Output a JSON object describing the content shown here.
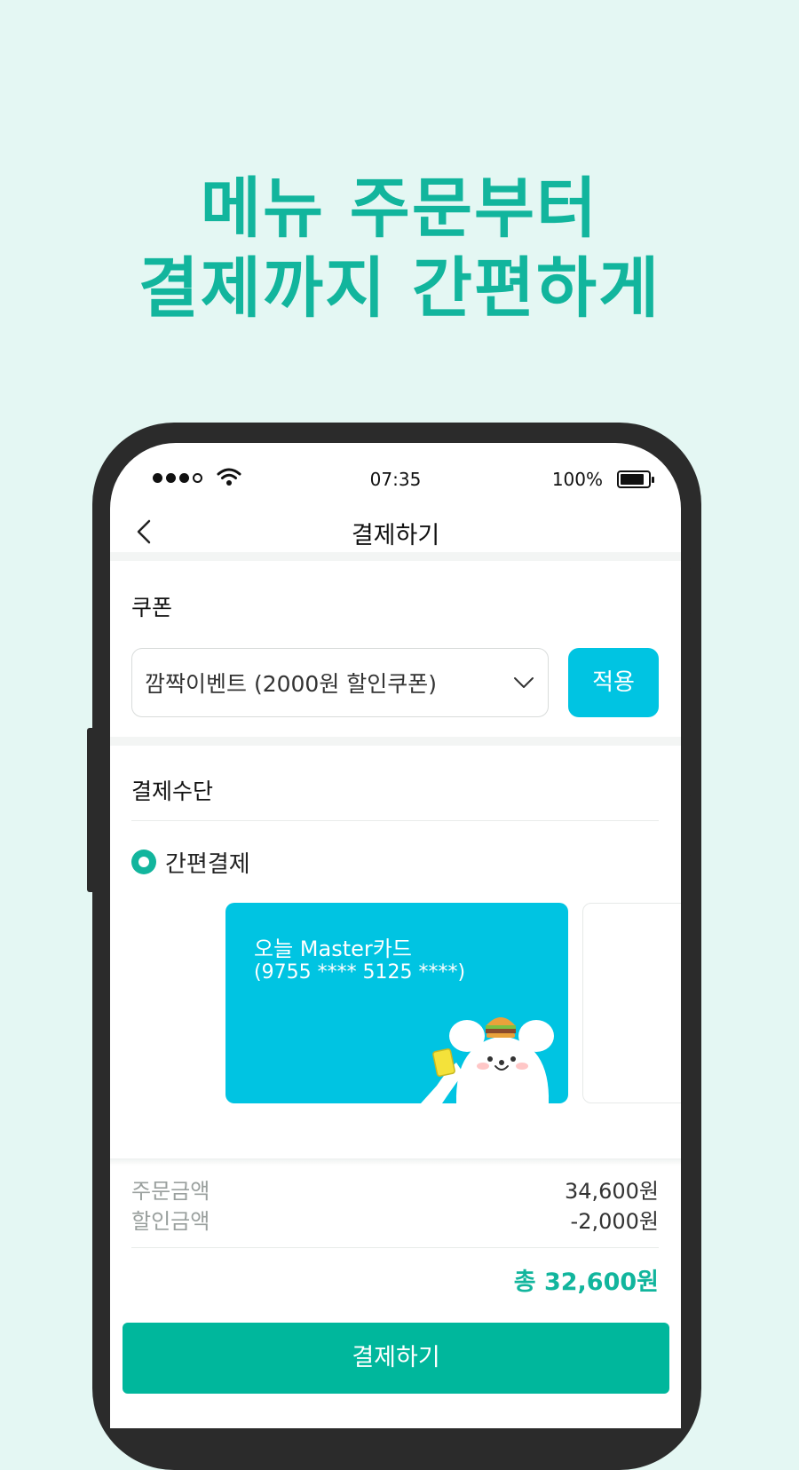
{
  "promo": {
    "line1": "메뉴 주문부터",
    "line2": "결제까지 간편하게"
  },
  "status_bar": {
    "time": "07:35",
    "battery": "100%"
  },
  "nav": {
    "title": "결제하기"
  },
  "coupon": {
    "section_title": "쿠폰",
    "selected": "깜짝이벤트 (2000원 할인쿠폰)",
    "apply_label": "적용"
  },
  "payment": {
    "section_title": "결제수단",
    "option_label": "간편결제",
    "card": {
      "name": "오늘 Master카드",
      "number": "(9755 **** 5125 ****)"
    }
  },
  "summary": {
    "order_label": "주문금액",
    "order_value": "34,600원",
    "discount_label": "할인금액",
    "discount_value": "-2,000원",
    "total": "총 32,600원"
  },
  "pay_button": "결제하기",
  "colors": {
    "brand": "#12b59d",
    "accent": "#00c4e2",
    "pay_button": "#00b79c",
    "background": "#e4f7f3"
  }
}
